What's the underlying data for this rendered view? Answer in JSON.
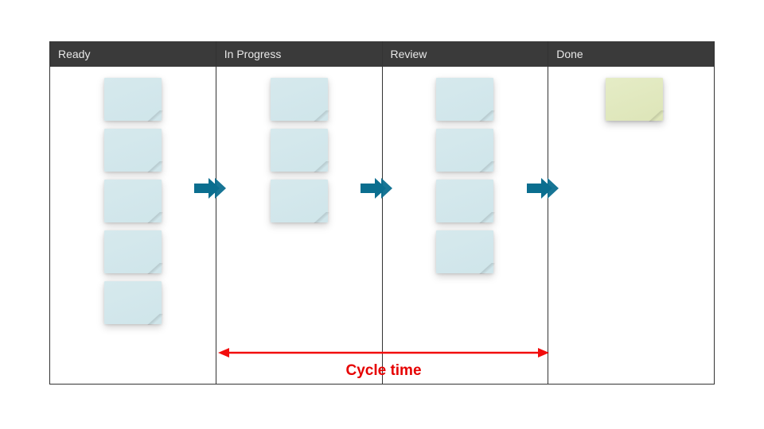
{
  "columns": {
    "0": {
      "label": "Ready",
      "card_count": 5,
      "card_color": "blue"
    },
    "1": {
      "label": "In Progress",
      "card_count": 3,
      "card_color": "blue"
    },
    "2": {
      "label": "Review",
      "card_count": 4,
      "card_color": "blue"
    },
    "3": {
      "label": "Done",
      "card_count": 1,
      "card_color": "green"
    }
  },
  "cycle_label": "Cycle time",
  "colors": {
    "header_bg": "#3a3a3a",
    "arrow": "#0b6e8f",
    "cycle": "#e60000",
    "card_blue": "#cfe5ea",
    "card_green": "#dde5b8"
  }
}
